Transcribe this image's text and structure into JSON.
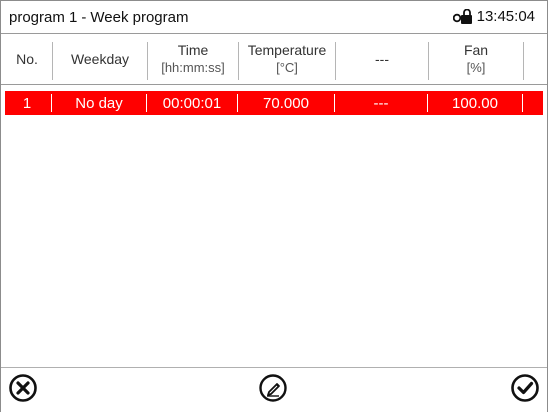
{
  "title": {
    "program": "program 1",
    "separator": "-",
    "mode": "Week program"
  },
  "status": {
    "time": "13:45:04",
    "lock_icon": "unlocked-lock-icon"
  },
  "table": {
    "columns": [
      {
        "label": "No.",
        "unit": ""
      },
      {
        "label": "Weekday",
        "unit": ""
      },
      {
        "label": "Time",
        "unit": "[hh:mm:ss]"
      },
      {
        "label": "Temperature",
        "unit": "[°C]"
      },
      {
        "label": "---",
        "unit": ""
      },
      {
        "label": "Fan",
        "unit": "[%]"
      }
    ],
    "rows": [
      {
        "no": "1",
        "weekday": "No day",
        "time": "00:00:01",
        "temperature": "70.000",
        "extra": "---",
        "fan": "100.00"
      }
    ],
    "selected_row_color": "#ff0000"
  },
  "footer": {
    "cancel_icon": "cancel-circle-icon",
    "edit_icon": "edit-pencil-icon",
    "confirm_icon": "confirm-check-icon"
  }
}
